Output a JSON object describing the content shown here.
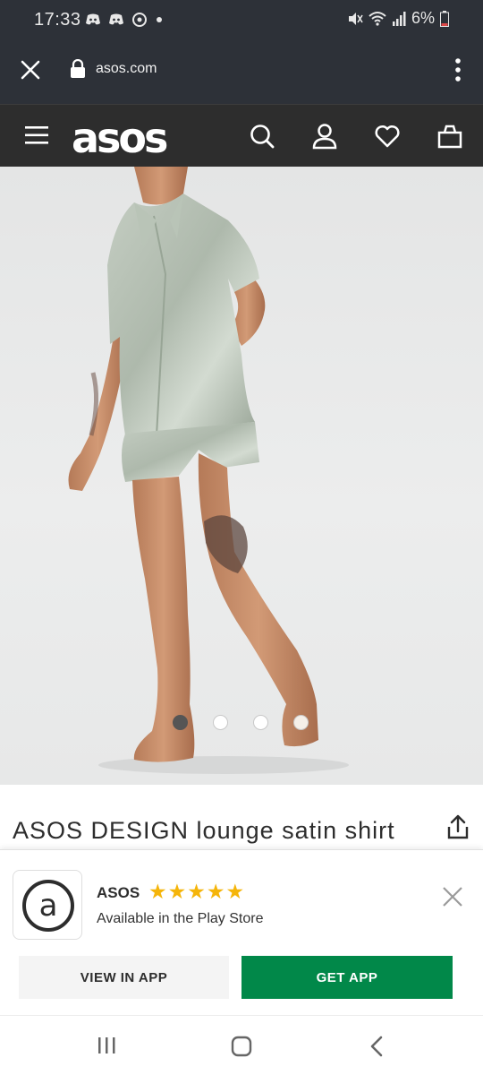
{
  "status_bar": {
    "time": "17:33",
    "battery": "6%",
    "icons": [
      "discord-icon",
      "discord-icon",
      "sync-icon",
      "dot-icon",
      "mute-icon",
      "wifi-icon",
      "signal-icon",
      "battery-icon"
    ]
  },
  "browser": {
    "url": "asos.com",
    "close_icon": "close-icon",
    "lock_icon": "lock-icon",
    "menu_icon": "kebab-menu-icon"
  },
  "site_header": {
    "logo": "asos",
    "icons": [
      "hamburger-menu-icon",
      "search-icon",
      "account-icon",
      "wishlist-heart-icon",
      "bag-icon"
    ]
  },
  "gallery": {
    "image_count": 4,
    "active_index": 0
  },
  "product": {
    "title": "ASOS DESIGN lounge satin shirt"
  },
  "app_banner": {
    "app_name": "ASOS",
    "stars": "★★★★★",
    "rating": 5,
    "store_text": "Available in the Play Store",
    "view_button": "VIEW IN APP",
    "get_button": "GET APP"
  },
  "nav": {
    "icons": [
      "recent-apps-icon",
      "home-icon",
      "back-icon"
    ]
  },
  "colors": {
    "header_bg": "#2d2d2d",
    "browser_bg": "#2d3138",
    "accent_green": "#018849",
    "star": "#f5b50a"
  }
}
